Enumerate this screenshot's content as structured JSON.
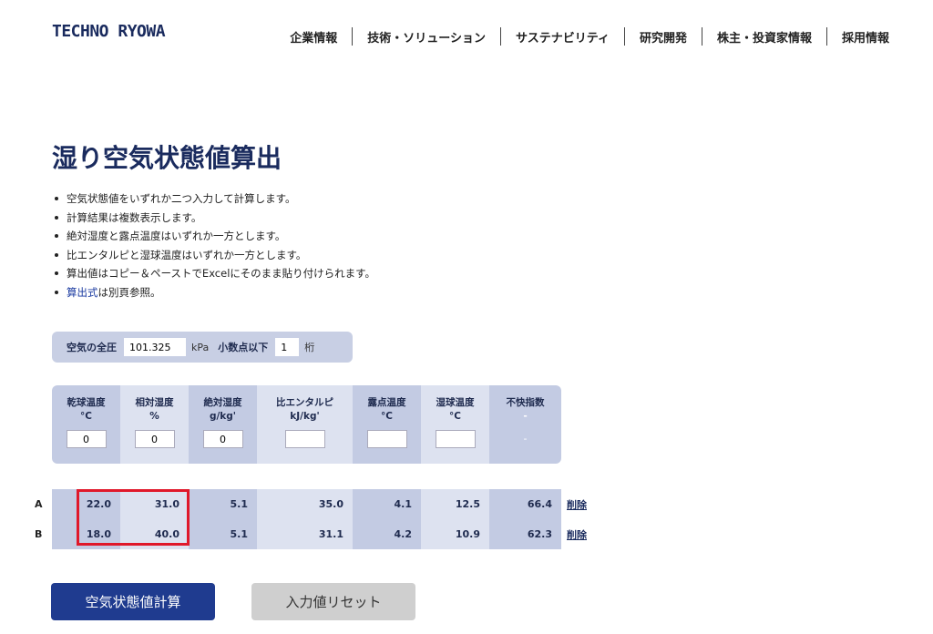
{
  "header": {
    "logo": "TECHNO RYOWA",
    "nav": [
      "企業情報",
      "技術・ソリューション",
      "サステナビリティ",
      "研究開発",
      "株主・投資家情報",
      "採用情報"
    ]
  },
  "page": {
    "title": "湿り空気状態値算出",
    "bullets": [
      "空気状態値をいずれか二つ入力して計算します。",
      "計算結果は複数表示します。",
      "絶対湿度と露点温度はいずれか一方とします。",
      "比エンタルピと湿球温度はいずれか一方とします。",
      "算出値はコピー＆ペーストでExcelにそのまま貼り付けられます。"
    ],
    "formula_link": "算出式",
    "formula_suffix": "は別頁参照。"
  },
  "pressure": {
    "label": "空気の全圧",
    "value": "101.325",
    "unit": "kPa",
    "decimal_label": "小数点以下",
    "decimal_value": "1",
    "decimal_unit": "桁"
  },
  "input_columns": [
    {
      "h1": "乾球温度",
      "h2": "°C",
      "value": "0",
      "has_input": true
    },
    {
      "h1": "相対湿度",
      "h2": "%",
      "value": "0",
      "has_input": true
    },
    {
      "h1": "絶対湿度",
      "h2": "g/kg'",
      "value": "0",
      "has_input": true
    },
    {
      "h1": "比エンタルピ",
      "h2": "kJ/kg'",
      "value": "",
      "has_input": true
    },
    {
      "h1": "露点温度",
      "h2": "°C",
      "value": "",
      "has_input": true
    },
    {
      "h1": "湿球温度",
      "h2": "°C",
      "value": "",
      "has_input": true
    },
    {
      "h1": "不快指数",
      "h2": "-",
      "value": "-",
      "has_input": false
    }
  ],
  "results": [
    {
      "label": "A",
      "values": [
        "22.0",
        "31.0",
        "5.1",
        "35.0",
        "4.1",
        "12.5",
        "66.4"
      ],
      "delete": "削除"
    },
    {
      "label": "B",
      "values": [
        "18.0",
        "40.0",
        "5.1",
        "31.1",
        "4.2",
        "10.9",
        "62.3"
      ],
      "delete": "削除"
    }
  ],
  "buttons": {
    "calculate": "空気状態値計算",
    "reset": "入力値リセット"
  },
  "colors": {
    "brand": "#1a2b5e",
    "highlight": "#e0182a"
  }
}
